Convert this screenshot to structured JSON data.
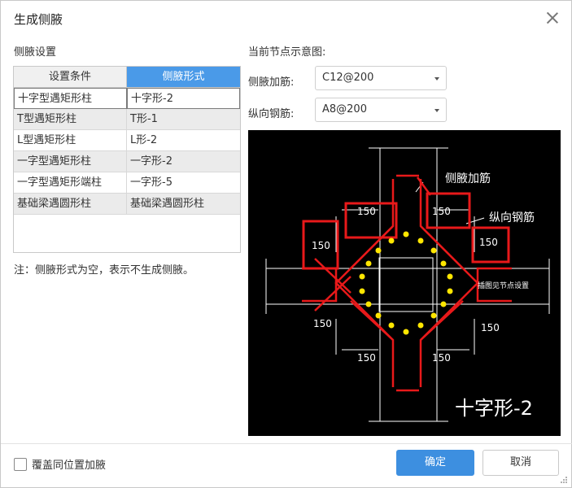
{
  "dialog": {
    "title": "生成侧腋"
  },
  "left": {
    "section_label": "侧腋设置",
    "columns": [
      "设置条件",
      "侧腋形式"
    ],
    "rows": [
      {
        "condition": "十字型遇矩形柱",
        "form": "十字形-2"
      },
      {
        "condition": "T型遇矩形柱",
        "form": "T形-1"
      },
      {
        "condition": "L型遇矩形柱",
        "form": "L形-2"
      },
      {
        "condition": "一字型遇矩形柱",
        "form": "一字形-2"
      },
      {
        "condition": "一字型遇矩形端柱",
        "form": "一字形-5"
      },
      {
        "condition": "基础梁遇圆形柱",
        "form": "基础梁遇圆形柱"
      }
    ],
    "note": "注：侧腋形式为空，表示不生成侧腋。"
  },
  "right": {
    "section_label": "当前节点示意图:",
    "side_rebar_label": "侧腋加筋:",
    "side_rebar_value": "C12@200",
    "long_rebar_label": "纵向钢筋:",
    "long_rebar_value": "A8@200",
    "diagram": {
      "label_side": "侧腋加筋",
      "label_long": "纵向钢筋",
      "dim": "150",
      "note_small": "插图见节点设置",
      "type_label": "十字形-2"
    }
  },
  "footer": {
    "checkbox_label": "覆盖同位置加腋",
    "ok_label": "确定",
    "cancel_label": "取消"
  },
  "colors": {
    "accent": "#3d8fe0",
    "header_active": "#4a9ae8",
    "diagram_red": "#e8191a",
    "diagram_yellow": "#ffe600"
  }
}
